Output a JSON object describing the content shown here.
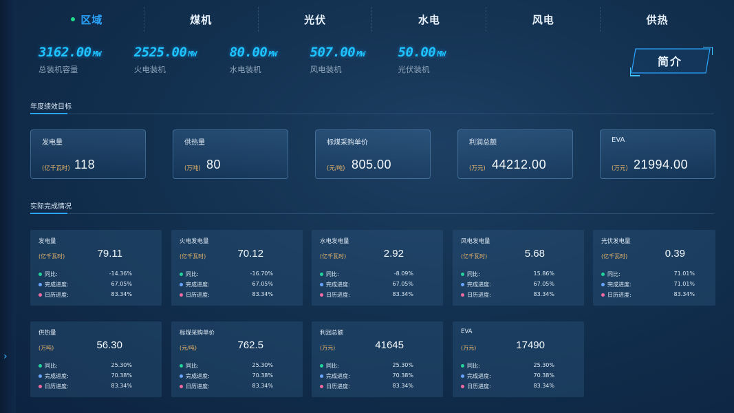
{
  "nav": {
    "tabs": [
      {
        "label": "区域",
        "active": true
      },
      {
        "label": "煤机",
        "active": false
      },
      {
        "label": "光伏",
        "active": false
      },
      {
        "label": "水电",
        "active": false
      },
      {
        "label": "风电",
        "active": false
      },
      {
        "label": "供热",
        "active": false
      }
    ]
  },
  "stats": [
    {
      "value": "3162.00",
      "unit": "MW",
      "label": "总装机容量"
    },
    {
      "value": "2525.00",
      "unit": "MW",
      "label": "火电装机"
    },
    {
      "value": "80.00",
      "unit": "MW",
      "label": "水电装机"
    },
    {
      "value": "507.00",
      "unit": "MW",
      "label": "风电装机"
    },
    {
      "value": "50.00",
      "unit": "MW",
      "label": "光伏装机"
    }
  ],
  "intro_button": "简介",
  "annual_section": {
    "title": "年度绩效目标"
  },
  "targets": [
    {
      "label": "发电量",
      "unit": "(亿千瓦时)",
      "value": "118"
    },
    {
      "label": "供热量",
      "unit": "(万吨)",
      "value": "80"
    },
    {
      "label": "标煤采购单价",
      "unit": "(元/吨)",
      "value": "805.00"
    },
    {
      "label": "利润总额",
      "unit": "(万元)",
      "value": "44212.00"
    },
    {
      "label": "EVA",
      "unit": "(万元)",
      "value": "21994.00"
    }
  ],
  "actual_section": {
    "title": "实际完成情况"
  },
  "metric_labels": {
    "yoy": "同比:",
    "progress": "完成进度:",
    "calendar": "日历进度:"
  },
  "colors": {
    "yoy": "#22d39a",
    "progress": "#6aa6ff",
    "calendar": "#f06aa0",
    "accent": "#2aa5ff",
    "stat": "#1ec4ff",
    "unit": "#e8b56a"
  },
  "actuals": [
    {
      "label": "发电量",
      "unit": "(亿千瓦时)",
      "value": "79.11",
      "yoy": "-14.36%",
      "progress": "67.05%",
      "calendar": "83.34%"
    },
    {
      "label": "火电发电量",
      "unit": "(亿千瓦时)",
      "value": "70.12",
      "yoy": "-16.70%",
      "progress": "67.05%",
      "calendar": "83.34%"
    },
    {
      "label": "水电发电量",
      "unit": "(亿千瓦时)",
      "value": "2.92",
      "yoy": "-8.09%",
      "progress": "67.05%",
      "calendar": "83.34%"
    },
    {
      "label": "风电发电量",
      "unit": "(亿千瓦时)",
      "value": "5.68",
      "yoy": "15.86%",
      "progress": "67.05%",
      "calendar": "83.34%"
    },
    {
      "label": "光伏发电量",
      "unit": "(亿千瓦时)",
      "value": "0.39",
      "yoy": "71.01%",
      "progress": "71.01%",
      "calendar": "83.34%"
    },
    {
      "label": "供热量",
      "unit": "(万吨)",
      "value": "56.30",
      "yoy": "25.30%",
      "progress": "70.38%",
      "calendar": "83.34%"
    },
    {
      "label": "标煤采购单价",
      "unit": "(元/吨)",
      "value": "762.5",
      "yoy": "25.30%",
      "progress": "70.38%",
      "calendar": "83.34%"
    },
    {
      "label": "利润总额",
      "unit": "(万元)",
      "value": "41645",
      "yoy": "25.30%",
      "progress": "70.38%",
      "calendar": "83.34%"
    },
    {
      "label": "EVA",
      "unit": "(万元)",
      "value": "17490",
      "yoy": "25.30%",
      "progress": "70.38%",
      "calendar": "83.34%"
    }
  ],
  "sidebar_toggle": "›"
}
